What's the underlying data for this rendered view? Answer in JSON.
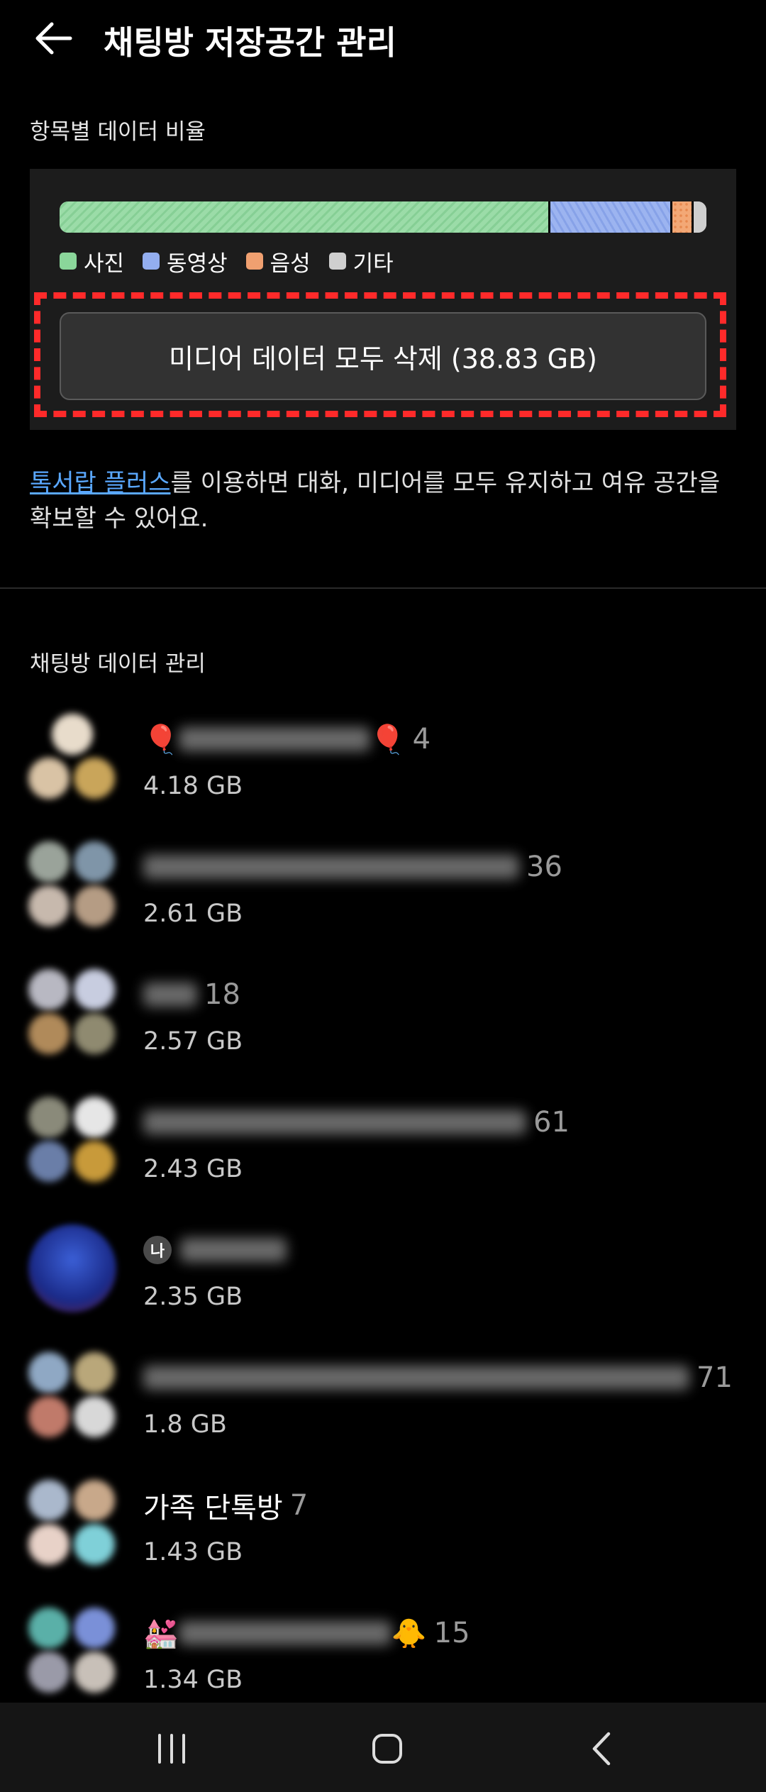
{
  "header": {
    "title": "채팅방 저장공간 관리"
  },
  "ratio_section": {
    "label": "항목별 데이터 비율",
    "bar": [
      {
        "name": "photo",
        "fraction": 0.755,
        "color": "#8ad69a"
      },
      {
        "name": "video",
        "fraction": 0.185,
        "color": "#93aef0"
      },
      {
        "name": "audio",
        "fraction": 0.03,
        "color": "#f0a070"
      },
      {
        "name": "etc",
        "fraction": 0.03,
        "color": "#cfcfcf"
      }
    ],
    "legend": {
      "photo": "사진",
      "video": "동영상",
      "audio": "음성",
      "etc": "기타"
    },
    "delete_button": "미디어 데이터 모두 삭제 (38.83 GB)"
  },
  "promo": {
    "link": "톡서랍 플러스",
    "text": "를 이용하면 대화, 미디어를 모두 유지하고 여유 공간을 확보할 수 있어요."
  },
  "chat_section": {
    "label": "채팅방 데이터 관리",
    "rooms": [
      {
        "prefix": "🎈",
        "suffix": "🎈",
        "count": "4",
        "size": "4.18 GB"
      },
      {
        "count": "36",
        "size": "2.61 GB"
      },
      {
        "count": "18",
        "size": "2.57 GB"
      },
      {
        "count": "61",
        "size": "2.43 GB"
      },
      {
        "badge": "나",
        "count": "",
        "size": "2.35 GB"
      },
      {
        "count": "71",
        "size": "1.8 GB"
      },
      {
        "name": "가족 단톡방",
        "count": "7",
        "size": "1.43 GB"
      },
      {
        "prefix": "💒",
        "suffix": "🐥",
        "count": "15",
        "size": "1.34 GB"
      }
    ]
  },
  "navbar": {
    "icons": [
      "recent-apps-icon",
      "home-icon",
      "back-icon"
    ]
  },
  "colors": {
    "background": "#000000",
    "link": "#5aa8ff",
    "highlight": "#ff2a2a"
  }
}
